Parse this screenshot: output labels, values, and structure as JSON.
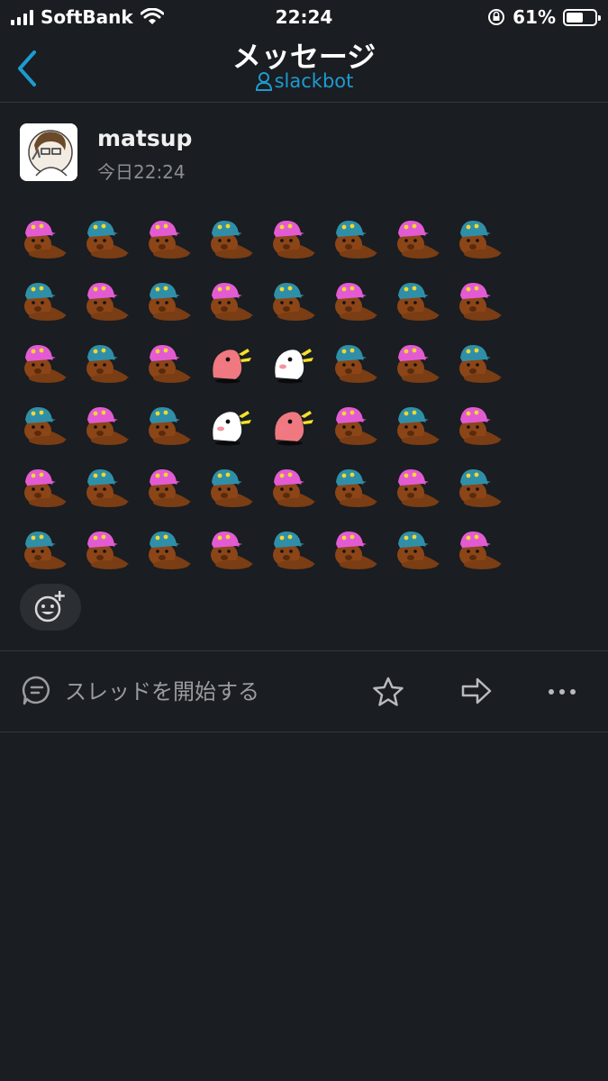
{
  "status": {
    "carrier": "SoftBank",
    "time": "22:24",
    "battery_percent": "61%",
    "battery_level": 0.61
  },
  "nav": {
    "title": "メッセージ",
    "subtitle": "slackbot"
  },
  "message": {
    "author": "matsup",
    "timestamp": "今日22:24",
    "emoji_grid": [
      [
        "beaver-pink",
        "beaver-blue",
        "beaver-pink",
        "beaver-blue",
        "beaver-pink",
        "beaver-blue",
        "beaver-pink",
        "beaver-blue"
      ],
      [
        "beaver-blue",
        "beaver-pink",
        "beaver-blue",
        "beaver-pink",
        "beaver-blue",
        "beaver-pink",
        "beaver-blue",
        "beaver-pink"
      ],
      [
        "beaver-pink",
        "beaver-blue",
        "beaver-pink",
        "bird-pink",
        "bird-white",
        "beaver-blue",
        "beaver-pink",
        "beaver-blue"
      ],
      [
        "beaver-blue",
        "beaver-pink",
        "beaver-blue",
        "bird-white",
        "bird-pink",
        "beaver-pink",
        "beaver-blue",
        "beaver-pink"
      ],
      [
        "beaver-pink",
        "beaver-blue",
        "beaver-pink",
        "beaver-blue",
        "beaver-pink",
        "beaver-blue",
        "beaver-pink",
        "beaver-blue"
      ],
      [
        "beaver-blue",
        "beaver-pink",
        "beaver-blue",
        "beaver-pink",
        "beaver-blue",
        "beaver-pink",
        "beaver-blue",
        "beaver-pink"
      ]
    ]
  },
  "actions": {
    "thread_label": "スレッドを開始する"
  },
  "colors": {
    "background": "#1a1d21",
    "link": "#1d9bd1",
    "muted": "#9a9c9f"
  }
}
